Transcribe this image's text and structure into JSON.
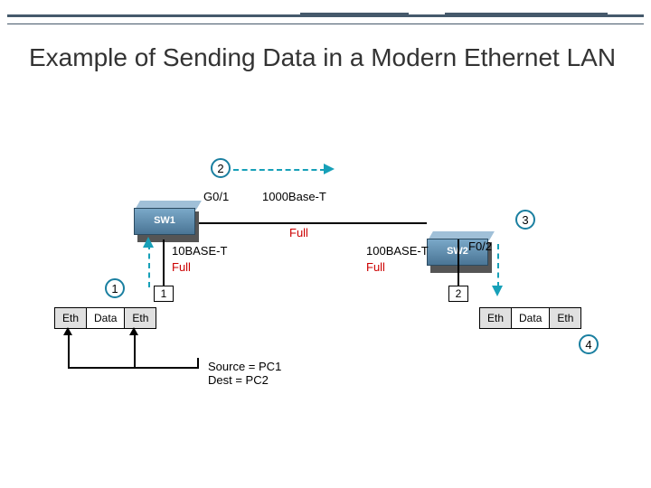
{
  "title": "Example of Sending Data in a Modern Ethernet LAN",
  "steps": {
    "s1": "1",
    "s2": "2",
    "s3": "3",
    "s4": "4"
  },
  "switches": {
    "sw1": "SW1",
    "sw2": "SW2"
  },
  "ports": {
    "sw1_up": "G0/1",
    "sw2_down": "F0/2"
  },
  "links": {
    "trunk_type": "1000Base-T",
    "trunk_duplex": "Full",
    "left_type": "10BASE-T",
    "left_duplex": "Full",
    "right_type": "100BASE-T",
    "right_duplex": "Full"
  },
  "frame": {
    "eth": "Eth",
    "data": "Data"
  },
  "pcs": {
    "pc1": "1",
    "pc2": "2"
  },
  "callout": {
    "source": "Source = PC1",
    "dest": "Dest = PC2"
  }
}
